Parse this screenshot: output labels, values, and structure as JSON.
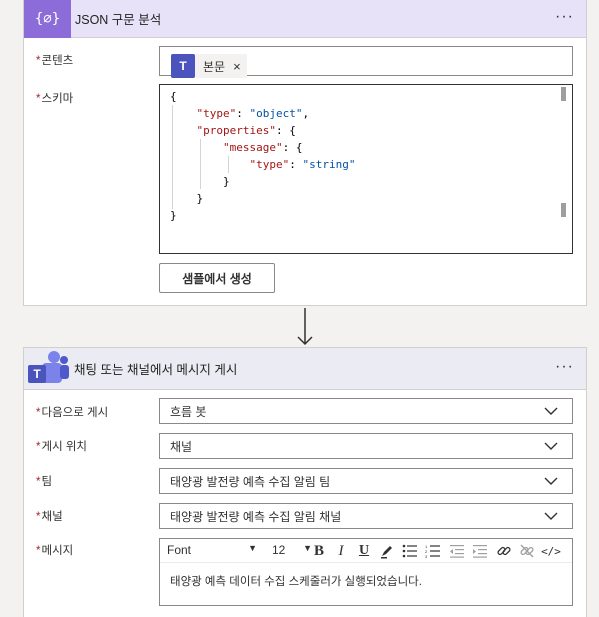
{
  "json_action": {
    "title": "JSON 구문 분석",
    "icon": "{∅}",
    "more": "···",
    "content_label": "콘텐츠",
    "content_token": {
      "icon_letter": "T",
      "label": "본문",
      "remove": "×"
    },
    "schema_label": "스키마",
    "schema_lines": [
      "{",
      "    \"type\": \"object\",",
      "    \"properties\": {",
      "        \"message\": {",
      "            \"type\": \"string\"",
      "        }",
      "    }",
      "}"
    ],
    "sample_button": "샘플에서 생성"
  },
  "teams_action": {
    "title": "채팅 또는 채널에서 메시지 게시",
    "more": "···",
    "fields": [
      {
        "label": "다음으로 게시",
        "value": "흐름 봇"
      },
      {
        "label": "게시 위치",
        "value": "채널"
      },
      {
        "label": "팀",
        "value": "태양광 발전량 예측 수집 알림 팀"
      },
      {
        "label": "채널",
        "value": "태양광 발전량 예측 수집 알림 채널"
      }
    ],
    "message_label": "메시지",
    "toolbar": {
      "font": "Font",
      "font_caret": "▼",
      "size": "12",
      "size_caret": "▼"
    },
    "message_text": "태양광 예측 데이터 수집 스케줄러가 실행되었습니다."
  },
  "colors": {
    "json_accent": "#8c6cd9",
    "teams_accent": "#4b53bc",
    "required": "#a4262c"
  }
}
